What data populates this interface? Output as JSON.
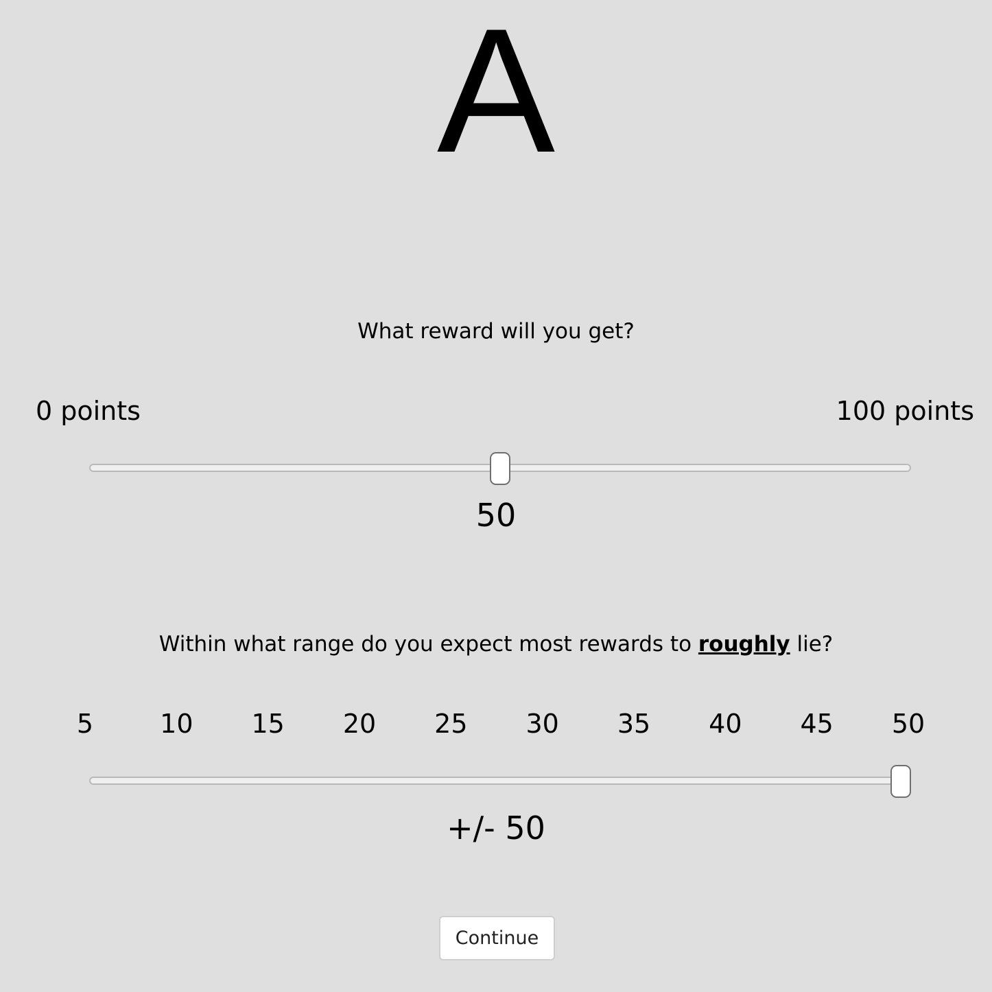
{
  "stimulus": {
    "letter": "A"
  },
  "reward_question": {
    "prompt": "What reward will you get?",
    "min_label": "0 points",
    "max_label": "100 points",
    "min": 0,
    "max": 100,
    "value": 50,
    "value_text": "50"
  },
  "range_question": {
    "prompt_before": "Within what range do you expect most rewards to ",
    "prompt_emphasis": "roughly",
    "prompt_after": " lie?",
    "ticks": [
      "5",
      "10",
      "15",
      "20",
      "25",
      "30",
      "35",
      "40",
      "45",
      "50"
    ],
    "min": 5,
    "max": 50,
    "value": 50,
    "value_text": "+/- 50"
  },
  "continue_button": {
    "label": "Continue"
  },
  "colors": {
    "background": "#dfdfdf",
    "track": "#efefef",
    "thumb": "#ffffff"
  }
}
